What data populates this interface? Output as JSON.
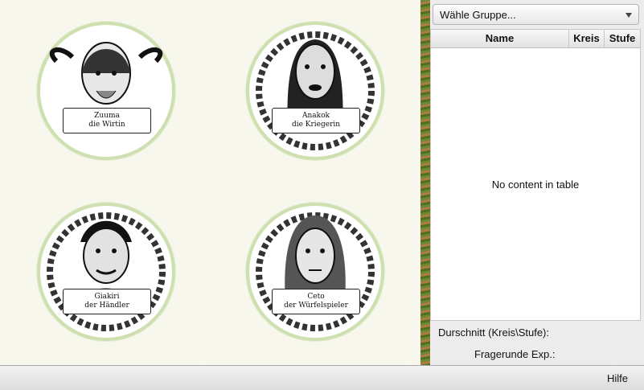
{
  "portraits": [
    {
      "name": "Zuuma",
      "title": "die Wirtin"
    },
    {
      "name": "Anakok",
      "title": "die Kriegerin"
    },
    {
      "name": "Giakiri",
      "title": "der Händler"
    },
    {
      "name": "Ceto",
      "title": "der Würfelspieler"
    }
  ],
  "group_select": {
    "value": "Wähle Gruppe..."
  },
  "table": {
    "columns": [
      "Name",
      "Kreis",
      "Stufe"
    ],
    "empty_text": "No content in table"
  },
  "stats": {
    "average_label": "Durschnitt (Kreis\\Stufe):",
    "exp_label": "Fragerunde Exp.:"
  },
  "footer": {
    "help_label": "Hilfe"
  }
}
